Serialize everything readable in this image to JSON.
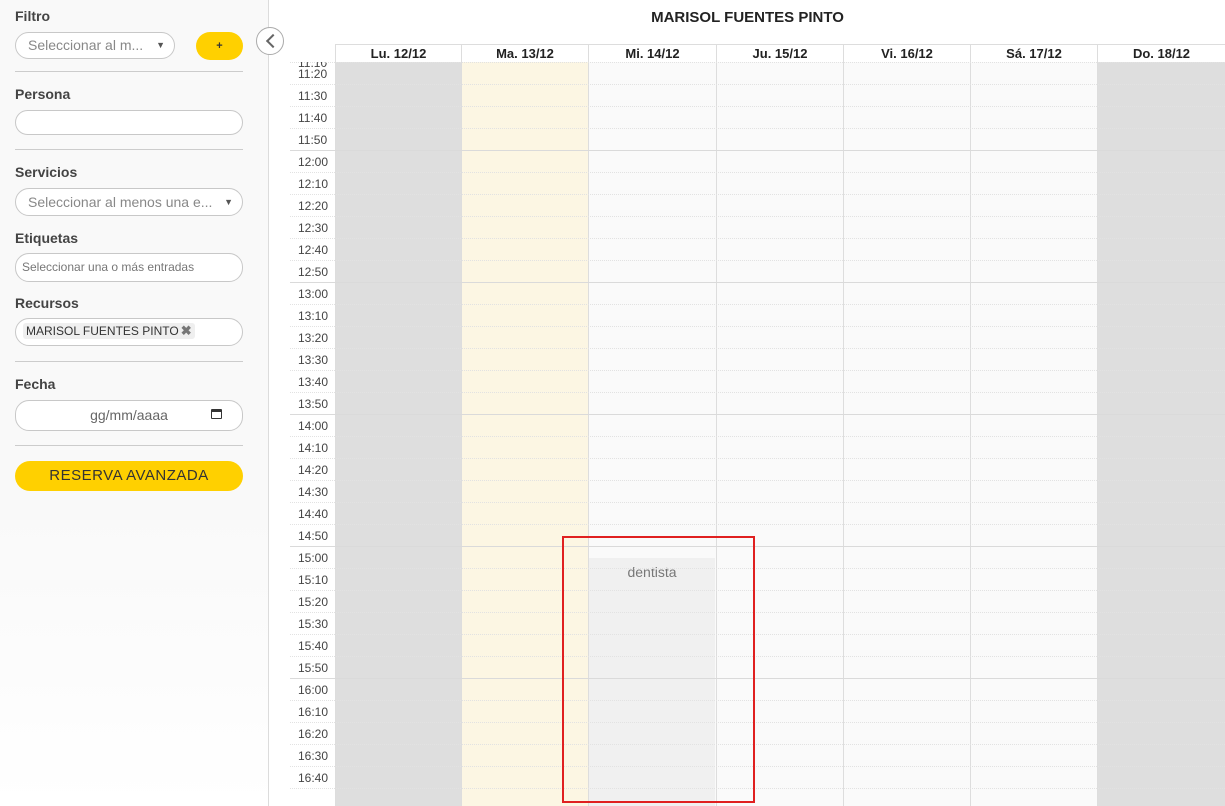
{
  "sidebar": {
    "filter": {
      "label": "Filtro",
      "placeholder": "Seleccionar al m...",
      "add_label": "+"
    },
    "person": {
      "label": "Persona",
      "value": ""
    },
    "services": {
      "label": "Servicios",
      "placeholder": "Seleccionar al menos una e..."
    },
    "tags": {
      "label": "Etiquetas",
      "placeholder": "Seleccionar una o más entradas"
    },
    "resources": {
      "label": "Recursos",
      "selected": "MARISOL FUENTES PINTO",
      "remove_icon": "close-icon"
    },
    "date": {
      "label": "Fecha",
      "placeholder": "gg/mm/aaaa",
      "icon": "calendar-icon"
    },
    "advanced_booking": "RESERVA AVANZADA",
    "collapse_icon": "chevron-left-icon"
  },
  "calendar": {
    "title": "MARISOL FUENTES PINTO",
    "days": [
      {
        "label": "Lu. 12/12",
        "bg": "#dedede"
      },
      {
        "label": "Ma. 13/12",
        "bg": "#fcf6e3"
      },
      {
        "label": "Mi. 14/12",
        "bg": "#fafafa"
      },
      {
        "label": "Ju. 15/12",
        "bg": "#fafafa"
      },
      {
        "label": "Vi. 16/12",
        "bg": "#fafafa"
      },
      {
        "label": "Sá. 17/12",
        "bg": "#fafafa"
      },
      {
        "label": "Do. 18/12",
        "bg": "#dedede"
      }
    ],
    "partial_top_time": "11:10",
    "times": [
      "11:20",
      "11:30",
      "11:40",
      "11:50",
      "12:00",
      "12:10",
      "12:20",
      "12:30",
      "12:40",
      "12:50",
      "13:00",
      "13:10",
      "13:20",
      "13:30",
      "13:40",
      "13:50",
      "14:00",
      "14:10",
      "14:20",
      "14:30",
      "14:40",
      "14:50",
      "15:00",
      "15:10",
      "15:20",
      "15:30",
      "15:40",
      "15:50",
      "16:00",
      "16:10",
      "16:20",
      "16:30",
      "16:40"
    ],
    "event": {
      "title": "dentista",
      "day": "Mi. 14/12",
      "start": "15:00",
      "end": "16:50"
    }
  },
  "colors": {
    "accent": "#ffd000",
    "highlight": "#e02020"
  }
}
